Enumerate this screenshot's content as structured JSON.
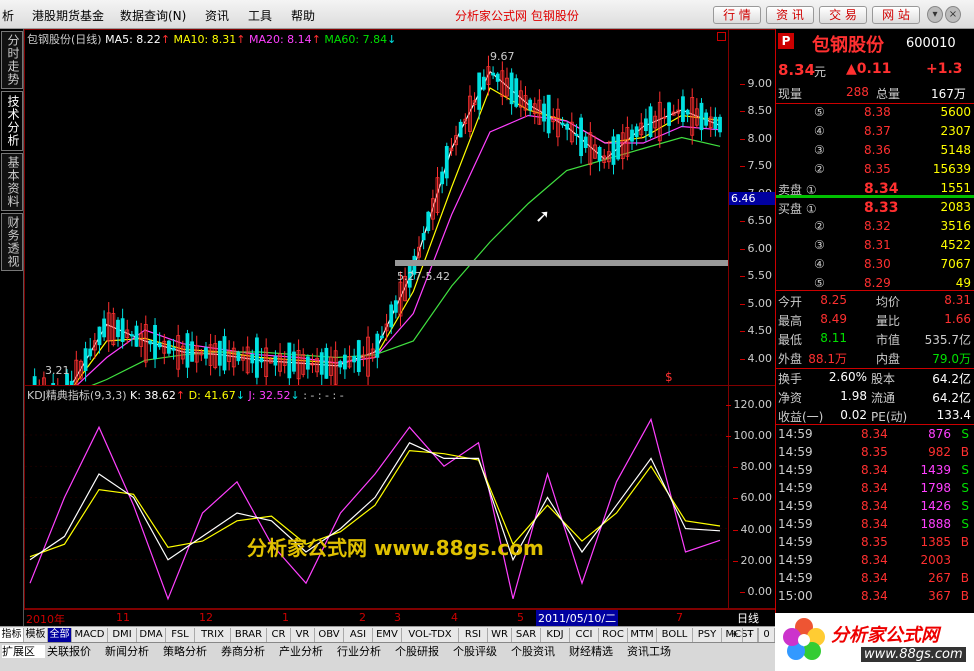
{
  "menubar": {
    "items": [
      "析",
      "港股期货基金",
      "数据查询(N)",
      "资讯",
      "工具",
      "帮助"
    ],
    "center_title": "分析家公式网 包钢股份",
    "buttons": [
      "行 情",
      "资 讯",
      "交 易",
      "网 站"
    ]
  },
  "left_tabs": [
    "分时走势",
    "技术分析",
    "基本资料",
    "财务透视"
  ],
  "main_chart": {
    "legend": {
      "name": "包钢股份(日线)",
      "ma5": "MA5: 8.22",
      "ma10": "MA10: 8.31",
      "ma20": "MA20: 8.14",
      "ma60": "MA60: 7.84"
    },
    "annotations": {
      "high": "9.67",
      "low": "3.21",
      "range": "5.27-5.42"
    },
    "price_tag": "6.46",
    "dollar_mark": "$"
  },
  "kdj": {
    "legend": {
      "name": "KDJ精典指标(9,3,3)",
      "k": "K: 38.62",
      "d": "D: 41.67",
      "j": "J: 32.52",
      "extra": ": - : - : -"
    },
    "watermark": "分析家公式网 www.88gs.com"
  },
  "chart_data": [
    {
      "type": "line",
      "title": "包钢股份(日线)",
      "ylim": [
        3.5,
        9.5
      ],
      "yticks": [
        "9.00",
        "8.50",
        "8.00",
        "7.50",
        "7.00",
        "6.50",
        "6.00",
        "5.50",
        "5.00",
        "4.50",
        "4.00"
      ],
      "x": [
        "2010年",
        "11",
        "12",
        "1",
        "2",
        "3",
        "4",
        "5",
        "2011/05/10/二",
        "7"
      ],
      "series": [
        {
          "name": "MA5",
          "color": "#ffffff",
          "values": [
            3.3,
            3.4,
            4.6,
            4.3,
            4.1,
            4.05,
            3.95,
            3.9,
            3.85,
            4.1,
            5.6,
            7.8,
            9.2,
            8.6,
            8.2,
            7.6,
            8.2,
            8.5,
            8.22
          ]
        },
        {
          "name": "MA10",
          "color": "#ffff00",
          "values": [
            3.3,
            3.35,
            4.3,
            4.35,
            4.15,
            4.1,
            4.0,
            3.95,
            3.9,
            4.0,
            5.2,
            7.1,
            8.9,
            8.5,
            8.3,
            7.9,
            8.0,
            8.4,
            8.31
          ]
        },
        {
          "name": "MA20",
          "color": "#ff40ff",
          "values": [
            3.3,
            3.35,
            4.0,
            4.5,
            4.25,
            4.15,
            4.05,
            4.0,
            3.9,
            4.0,
            4.8,
            6.6,
            8.1,
            8.4,
            8.3,
            7.9,
            7.9,
            8.2,
            8.14
          ]
        },
        {
          "name": "MA60",
          "color": "#40e040",
          "values": [
            3.3,
            3.32,
            3.6,
            3.95,
            4.05,
            4.1,
            4.1,
            4.05,
            4.0,
            4.05,
            4.3,
            5.3,
            6.1,
            6.8,
            7.4,
            7.6,
            7.8,
            8.0,
            7.84
          ]
        }
      ]
    },
    {
      "type": "line",
      "title": "KDJ精典指标(9,3,3)",
      "ylim": [
        0,
        125
      ],
      "yticks": [
        "120.00",
        "100.00",
        "80.00",
        "60.00",
        "40.00",
        "20.00",
        "0.00"
      ],
      "series": [
        {
          "name": "K",
          "color": "#ffffff",
          "values": [
            20,
            35,
            75,
            60,
            20,
            35,
            50,
            45,
            25,
            40,
            60,
            95,
            85,
            85,
            20,
            60,
            25,
            55,
            85,
            40,
            38.62
          ]
        },
        {
          "name": "D",
          "color": "#ffff00",
          "values": [
            22,
            30,
            65,
            62,
            28,
            32,
            45,
            48,
            30,
            38,
            55,
            90,
            88,
            84,
            30,
            55,
            32,
            50,
            80,
            45,
            41.67
          ]
        },
        {
          "name": "J",
          "color": "#ff40ff",
          "values": [
            5,
            60,
            105,
            55,
            -5,
            50,
            70,
            30,
            5,
            50,
            75,
            105,
            80,
            95,
            -5,
            75,
            5,
            70,
            110,
            25,
            32.52
          ]
        }
      ]
    }
  ],
  "datebar": {
    "labels": [
      "2010年",
      "11",
      "12",
      "1",
      "2",
      "3",
      "4",
      "5",
      "2011/05/10/二",
      "7"
    ],
    "period": "日线"
  },
  "indicators": [
    "指标",
    "模板",
    "全部",
    "MACD",
    "DMI",
    "DMA",
    "FSL",
    "TRIX",
    "BRAR",
    "CR",
    "VR",
    "OBV",
    "ASI",
    "EMV",
    "VOL-TDX",
    "RSI",
    "WR",
    "SAR",
    "KDJ",
    "CCI",
    "ROC",
    "MTM",
    "BOLL",
    "PSY",
    "MCST"
  ],
  "ind_nav": [
    "+",
    "-",
    "0"
  ],
  "groups": [
    "扩展区",
    "关联报价",
    "新闻分析",
    "策略分析",
    "券商分析",
    "产业分析",
    "行业分析",
    "个股研报",
    "个股评级",
    "个股资讯",
    "财经精选",
    "资讯工场"
  ],
  "quote": {
    "flag": "P",
    "name": "包钢股份",
    "code": "600010",
    "price": "8.34",
    "unit": "元",
    "change": "▲0.11",
    "pct": "+1.3",
    "now_vol_label": "现量",
    "now_vol": "288",
    "total_label": "总量",
    "total": "167万",
    "asks": [
      {
        "lvl": "⑤",
        "p": "8.38",
        "v": "5600"
      },
      {
        "lvl": "④",
        "p": "8.37",
        "v": "2307"
      },
      {
        "lvl": "③",
        "p": "8.36",
        "v": "5148"
      },
      {
        "lvl": "②",
        "p": "8.35",
        "v": "15639"
      },
      {
        "lvl": "卖盘 ①",
        "p": "8.34",
        "v": "1551"
      }
    ],
    "bids": [
      {
        "lvl": "买盘 ①",
        "p": "8.33",
        "v": "2083"
      },
      {
        "lvl": "②",
        "p": "8.32",
        "v": "3516"
      },
      {
        "lvl": "③",
        "p": "8.31",
        "v": "4522"
      },
      {
        "lvl": "④",
        "p": "8.30",
        "v": "7067"
      },
      {
        "lvl": "⑤",
        "p": "8.29",
        "v": "49"
      }
    ],
    "stats": [
      {
        "l1": "今开",
        "v1": "8.25",
        "c1": "red",
        "l2": "均价",
        "v2": "8.31",
        "c2": "red"
      },
      {
        "l1": "最高",
        "v1": "8.49",
        "c1": "red",
        "l2": "量比",
        "v2": "1.66",
        "c2": "red"
      },
      {
        "l1": "最低",
        "v1": "8.11",
        "c1": "green",
        "l2": "市值",
        "v2": "535.7亿",
        "c2": "gr"
      },
      {
        "l1": "外盘",
        "v1": "88.1万",
        "c1": "red",
        "l2": "内盘",
        "v2": "79.0万",
        "c2": "green"
      }
    ],
    "stats2": [
      {
        "l1": "换手",
        "v1": "2.60%",
        "l2": "股本",
        "v2": "64.2亿"
      },
      {
        "l1": "净资",
        "v1": "1.98",
        "l2": "流通",
        "v2": "64.2亿"
      },
      {
        "l1": "收益(一)",
        "v1": "0.02",
        "l2": "PE(动)",
        "v2": "133.4"
      }
    ],
    "ticks": [
      {
        "t": "14:59",
        "p": "8.34",
        "v": "876",
        "s": "S"
      },
      {
        "t": "14:59",
        "p": "8.35",
        "v": "982",
        "s": "B"
      },
      {
        "t": "14:59",
        "p": "8.34",
        "v": "1439",
        "s": "S"
      },
      {
        "t": "14:59",
        "p": "8.34",
        "v": "1798",
        "s": "S"
      },
      {
        "t": "14:59",
        "p": "8.34",
        "v": "1426",
        "s": "S"
      },
      {
        "t": "14:59",
        "p": "8.34",
        "v": "1888",
        "s": "S"
      },
      {
        "t": "14:59",
        "p": "8.35",
        "v": "1385",
        "s": "B"
      },
      {
        "t": "14:59",
        "p": "8.34",
        "v": "2003",
        "s": ""
      },
      {
        "t": "14:59",
        "p": "8.34",
        "v": "267",
        "s": "B"
      },
      {
        "t": "15:00",
        "p": "8.34",
        "v": "367",
        "s": "B"
      }
    ]
  },
  "logo_text": "分析家公式网",
  "logo_url": "www.88gs.com"
}
